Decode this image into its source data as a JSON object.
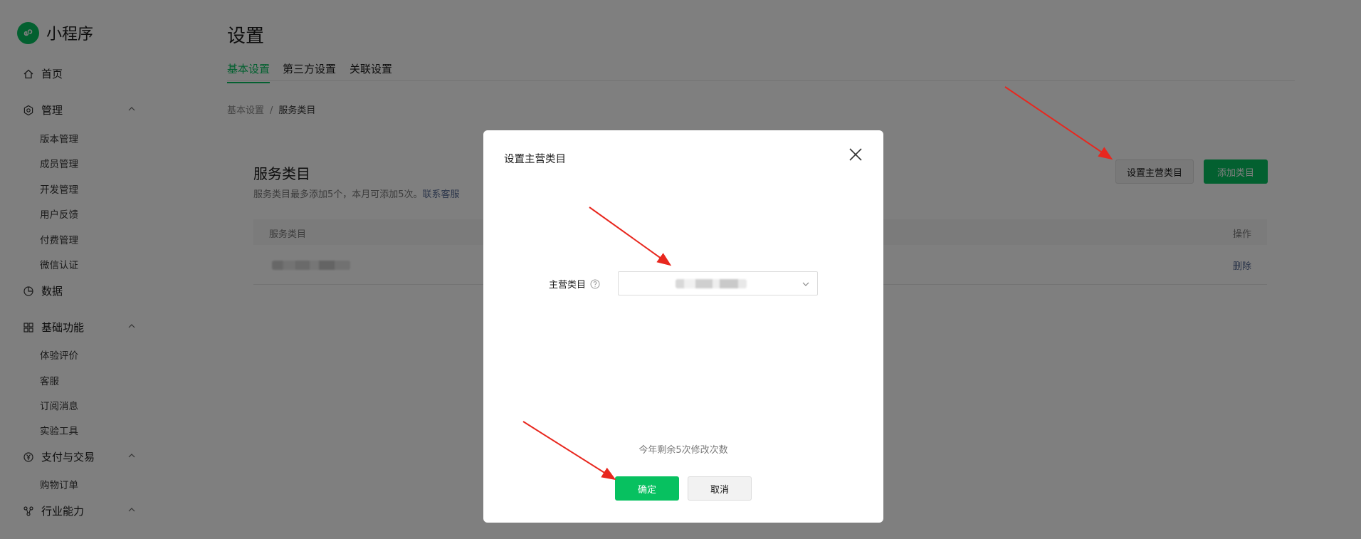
{
  "colors": {
    "brand": "#07c160",
    "link": "#576b95",
    "annotation_arrow": "#e8271e",
    "mask": "rgba(0,0,0,0.5)"
  },
  "sidebar": {
    "app_name": "小程序",
    "home": "首页",
    "groups": [
      {
        "label": "管理",
        "icon": "gear-icon",
        "items": [
          "版本管理",
          "成员管理",
          "开发管理",
          "用户反馈",
          "付费管理",
          "微信认证"
        ]
      },
      {
        "label": "数据",
        "icon": "pie-chart-icon",
        "items": []
      },
      {
        "label": "基础功能",
        "icon": "grid-icon",
        "items": [
          "体验评价",
          "客服",
          "订阅消息",
          "实验工具"
        ]
      },
      {
        "label": "支付与交易",
        "icon": "yen-icon",
        "items": [
          "购物订单"
        ]
      },
      {
        "label": "行业能力",
        "icon": "network-icon",
        "items": []
      }
    ]
  },
  "page": {
    "title": "设置",
    "tabs": [
      "基本设置",
      "第三方设置",
      "关联设置"
    ],
    "active_tab": 0,
    "breadcrumb": [
      "基本设置",
      "服务类目"
    ]
  },
  "card": {
    "title": "服务类目",
    "desc": "服务类目最多添加5个，本月可添加5次。",
    "contact_link": "联系客服",
    "set_main_button": "设置主营类目",
    "add_button": "添加类目",
    "table": {
      "headers": [
        "服务类目",
        "操作"
      ],
      "rows": [
        {
          "action": "删除"
        }
      ]
    }
  },
  "dialog": {
    "title": "设置主营类目",
    "field_label": "主营类目",
    "remaining": "今年剩余5次修改次数",
    "ok": "确定",
    "cancel": "取消"
  }
}
